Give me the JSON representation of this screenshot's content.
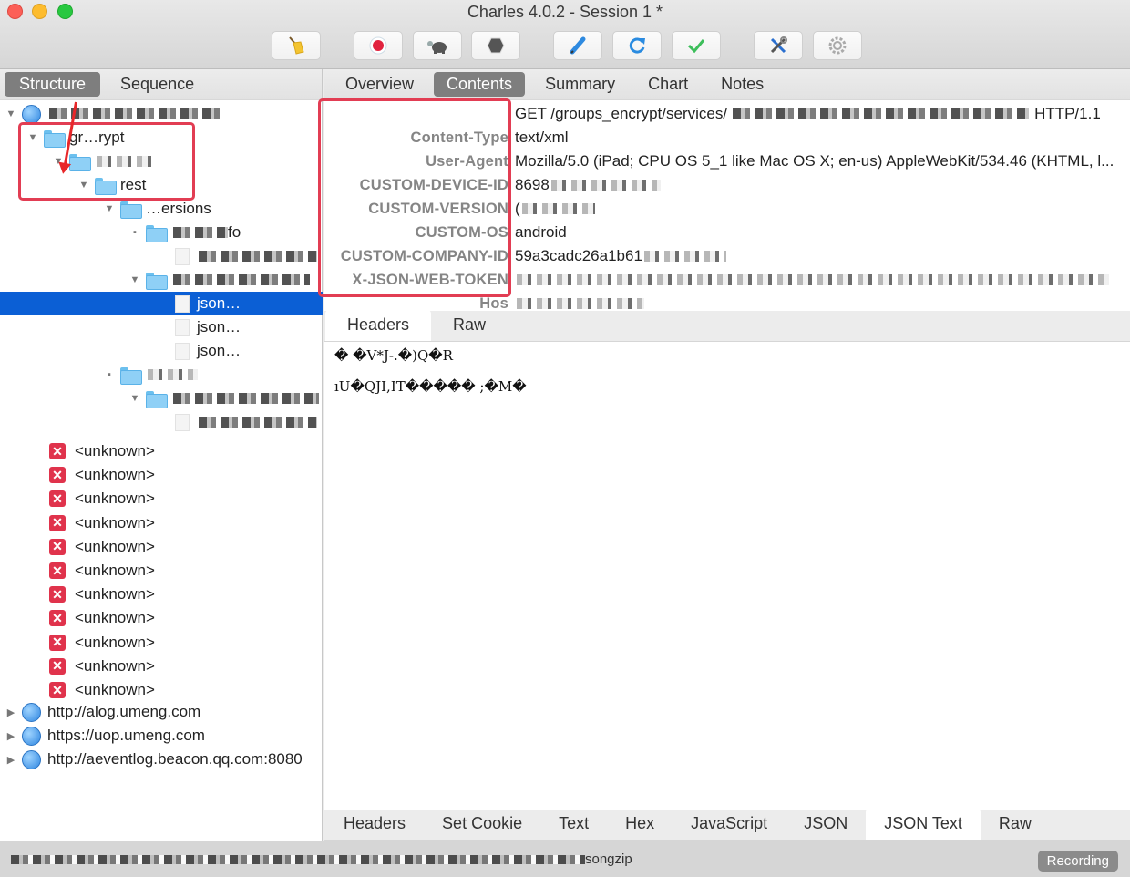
{
  "window": {
    "title": "Charles 4.0.2 - Session 1 *"
  },
  "toolbar": {
    "buttons": [
      {
        "name": "broom-icon",
        "label": "Clear session"
      },
      {
        "name": "record-icon",
        "label": "Record"
      },
      {
        "name": "turtle-icon",
        "label": "Throttle"
      },
      {
        "name": "stop-hexagon-icon",
        "label": "Breakpoints"
      },
      {
        "name": "pen-icon",
        "label": "Compose"
      },
      {
        "name": "refresh-icon",
        "label": "Repeat"
      },
      {
        "name": "checkmark-icon",
        "label": "Validate"
      },
      {
        "name": "tools-icon",
        "label": "Tools"
      },
      {
        "name": "gear-icon",
        "label": "Settings"
      }
    ]
  },
  "left_panel": {
    "tabs": [
      {
        "label": "Structure",
        "active": true
      },
      {
        "label": "Sequence",
        "active": false
      }
    ],
    "tree": {
      "rows": [
        {
          "label": "",
          "type": "host",
          "expanded": true,
          "redacted": true
        },
        {
          "label": "gr…rypt",
          "type": "folder",
          "expanded": true,
          "redacted": true
        },
        {
          "label": "",
          "type": "folder",
          "expanded": true,
          "redacted": true
        },
        {
          "label": "rest",
          "type": "folder",
          "expanded": true
        },
        {
          "label": "…ersions",
          "type": "folder",
          "expanded": true
        },
        {
          "label": "…info",
          "type": "folder",
          "expanded": false,
          "redacted": true
        },
        {
          "label": "",
          "type": "file",
          "redacted": true
        },
        {
          "label": "",
          "type": "folder",
          "expanded": true,
          "redacted": true
        },
        {
          "label": "json…",
          "type": "file",
          "selected": true,
          "redacted": true
        },
        {
          "label": "json…",
          "type": "file",
          "redacted": true
        },
        {
          "label": "json…",
          "type": "file",
          "redacted": true
        },
        {
          "label": "…s",
          "type": "folder",
          "expanded": false,
          "redacted": true
        },
        {
          "label": "",
          "type": "folder",
          "expanded": true,
          "redacted": true
        },
        {
          "label": "…g…",
          "type": "file",
          "redacted": true
        }
      ],
      "unknown_items": [
        "<unknown>",
        "<unknown>",
        "<unknown>",
        "<unknown>",
        "<unknown>",
        "<unknown>",
        "<unknown>",
        "<unknown>",
        "<unknown>",
        "<unknown>",
        "<unknown>"
      ],
      "hosts": [
        "http://alog.umeng.com",
        "https://uop.umeng.com",
        "http://aeventlog.beacon.qq.com:8080"
      ]
    }
  },
  "right_panel": {
    "tabs": [
      {
        "label": "Overview",
        "active": false
      },
      {
        "label": "Contents",
        "active": true
      },
      {
        "label": "Summary",
        "active": false
      },
      {
        "label": "Chart",
        "active": false
      },
      {
        "label": "Notes",
        "active": false
      }
    ],
    "request_line": {
      "method_path": "GET /groups_encrypt/services/",
      "protocol": "HTTP/1.1"
    },
    "headers": [
      {
        "key": "Content-Type",
        "value": "text/xml"
      },
      {
        "key": "User-Agent",
        "value": "Mozilla/5.0 (iPad; CPU OS 5_1 like Mac OS X; en-us) AppleWebKit/534.46 (KHTML, l..."
      },
      {
        "key": "CUSTOM-DEVICE-ID",
        "value": "8698"
      },
      {
        "key": "CUSTOM-VERSION",
        "value": "("
      },
      {
        "key": "CUSTOM-OS",
        "value": "android"
      },
      {
        "key": "CUSTOM-COMPANY-ID",
        "value": "59a3cadc26a1b61"
      },
      {
        "key": "X-JSON-WEB-TOKEN",
        "value": ""
      },
      {
        "key": "Hos",
        "value": ""
      }
    ],
    "request_tabs": [
      {
        "label": "Headers",
        "active": true
      },
      {
        "label": "Raw",
        "active": false
      }
    ],
    "body_lines": [
      "� �V*J-.�)Q�R",
      "ıU�QJI,IT����� ;�M�"
    ],
    "response_tabs": [
      {
        "label": "Headers",
        "active": false
      },
      {
        "label": "Set Cookie",
        "active": false
      },
      {
        "label": "Text",
        "active": false
      },
      {
        "label": "Hex",
        "active": false
      },
      {
        "label": "JavaScript",
        "active": false
      },
      {
        "label": "JSON",
        "active": false
      },
      {
        "label": "JSON Text",
        "active": true
      },
      {
        "label": "Raw",
        "active": false
      }
    ]
  },
  "status_bar": {
    "text_suffix": "songzip",
    "recording_label": "Recording"
  },
  "annotation_colors": {
    "highlight_box": "#e23d53",
    "arrow": "#e8272a"
  }
}
